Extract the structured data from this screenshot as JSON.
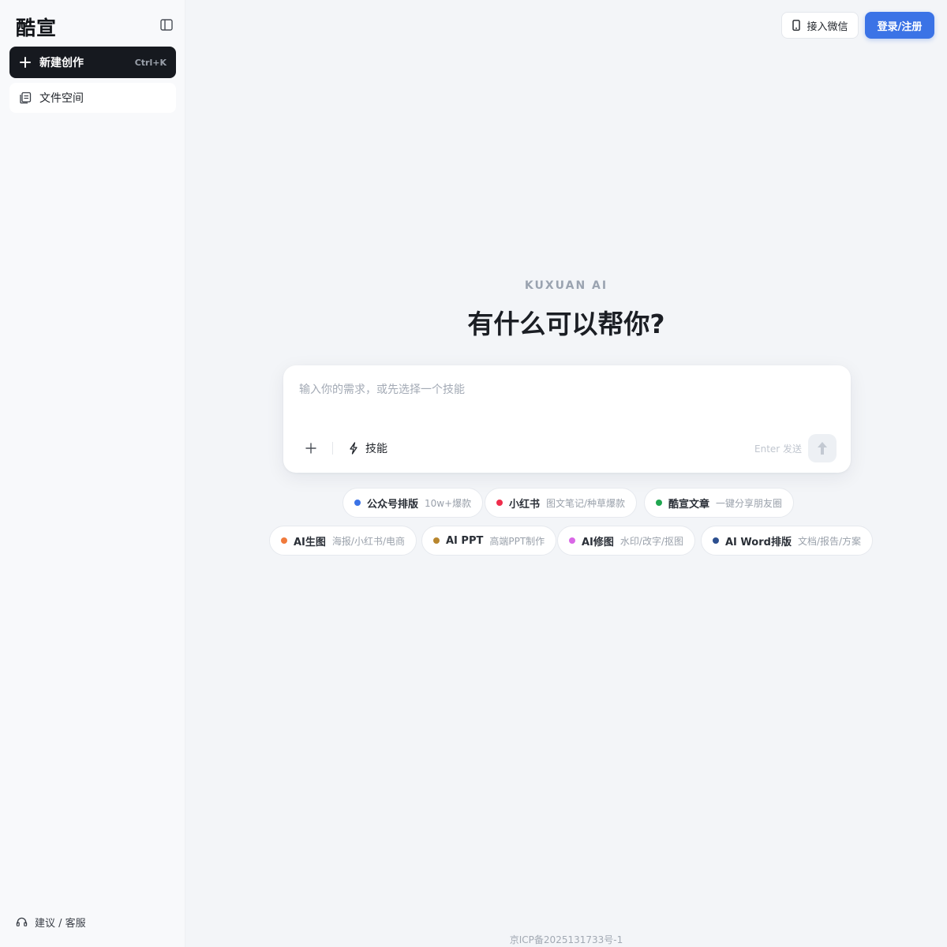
{
  "sidebar": {
    "brand": "酷宣",
    "new_label": "新建创作",
    "new_shortcut": "Ctrl+K",
    "files_label": "文件空间",
    "feedback_label": "建议 / 客服"
  },
  "header": {
    "wechat_label": "接入微信",
    "login_label": "登录/注册"
  },
  "main": {
    "eyebrow": "KUXUAN AI",
    "headline": "有什么可以帮你?",
    "composer": {
      "placeholder": "输入你的需求，或先选择一个技能",
      "skill_label": "技能",
      "enter_hint": "Enter 发送"
    },
    "chips": [
      {
        "title": "公众号排版",
        "sub": "10w+爆款",
        "color": "#3b73e6"
      },
      {
        "title": "小红书",
        "sub": "图文笔记/种草爆款",
        "color": "#ef2d4b"
      },
      {
        "title": "酷宣文章",
        "sub": "一键分享朋友圈",
        "color": "#20a650"
      },
      {
        "title": "AI生图",
        "sub": "海报/小红书/电商",
        "color": "#f07a3c"
      },
      {
        "title": "AI PPT",
        "sub": "高端PPT制作",
        "color": "#b8862e"
      },
      {
        "title": "AI修图",
        "sub": "水印/改字/抠图",
        "color": "#d967e6"
      },
      {
        "title": "AI Word排版",
        "sub": "文档/报告/方案",
        "color": "#2d4f8f"
      }
    ]
  },
  "footer": {
    "icp": "京ICP备2025131733号-1"
  },
  "colors": {
    "accent": "#3b73e6",
    "dark_button": "#16191f",
    "page_background": "#f3f5f8"
  },
  "icons": {
    "collapse": "sidebar-toggle-icon",
    "new": "plus-icon",
    "files": "files-icon",
    "feedback": "headset-icon",
    "wechat": "phone-icon",
    "attach": "plus-icon",
    "skill": "lightning-icon",
    "send": "arrow-up-icon"
  }
}
